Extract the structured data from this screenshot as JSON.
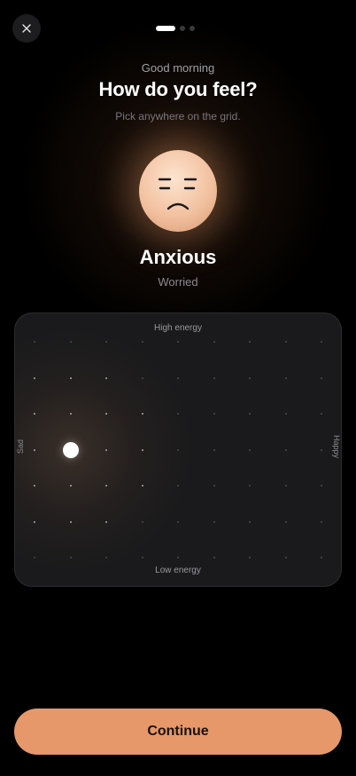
{
  "header": {
    "close_icon": "close-icon",
    "pager": {
      "total": 3,
      "current": 1
    }
  },
  "intro": {
    "greeting": "Good morning",
    "title": "How do you feel?",
    "subtitle": "Pick anywhere on the grid."
  },
  "mood": {
    "face_icon": "worried-face",
    "label": "Anxious",
    "sublabel": "Worried"
  },
  "grid": {
    "top_label": "High energy",
    "bottom_label": "Low energy",
    "left_label": "Sad",
    "right_label": "Happy",
    "columns": 9,
    "rows": 7,
    "selected": {
      "column": 2,
      "row": 4
    }
  },
  "footer": {
    "continue_label": "Continue"
  },
  "colors": {
    "accent": "#e6986b",
    "background": "#000000",
    "card": "#1a1a1c"
  }
}
